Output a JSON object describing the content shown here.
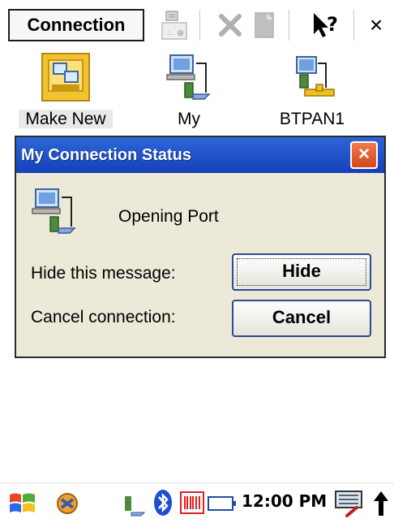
{
  "toolbar": {
    "menu_label": "Connection",
    "icons": [
      "properties-icon",
      "delete-icon",
      "document-icon",
      "help-icon",
      "close-icon"
    ],
    "close_label": "×"
  },
  "items": [
    {
      "label": "Make New",
      "icon": "make-new-connection-icon",
      "selected": true
    },
    {
      "label": "My",
      "icon": "network-connection-icon",
      "selected": false
    },
    {
      "label": "BTPAN1",
      "icon": "bluetooth-pan-icon",
      "selected": false
    }
  ],
  "dialog": {
    "title": "My Connection Status",
    "close_label": "×",
    "status": "Opening Port",
    "hide_label": "Hide this message:",
    "hide_button": "Hide",
    "cancel_label": "Cancel connection:",
    "cancel_button": "Cancel"
  },
  "taskbar": {
    "time": "12:00 PM",
    "icons": [
      "start-icon",
      "sync-icon",
      "network-icon",
      "bluetooth-icon",
      "barcode-icon",
      "battery-icon",
      "keyboard-icon",
      "up-arrow-icon"
    ]
  },
  "colors": {
    "title_bar": "#1e50c8",
    "dialog_bg": "#ece9d8",
    "close_button": "#e05a2f",
    "button_border": "#2c4c8c"
  }
}
